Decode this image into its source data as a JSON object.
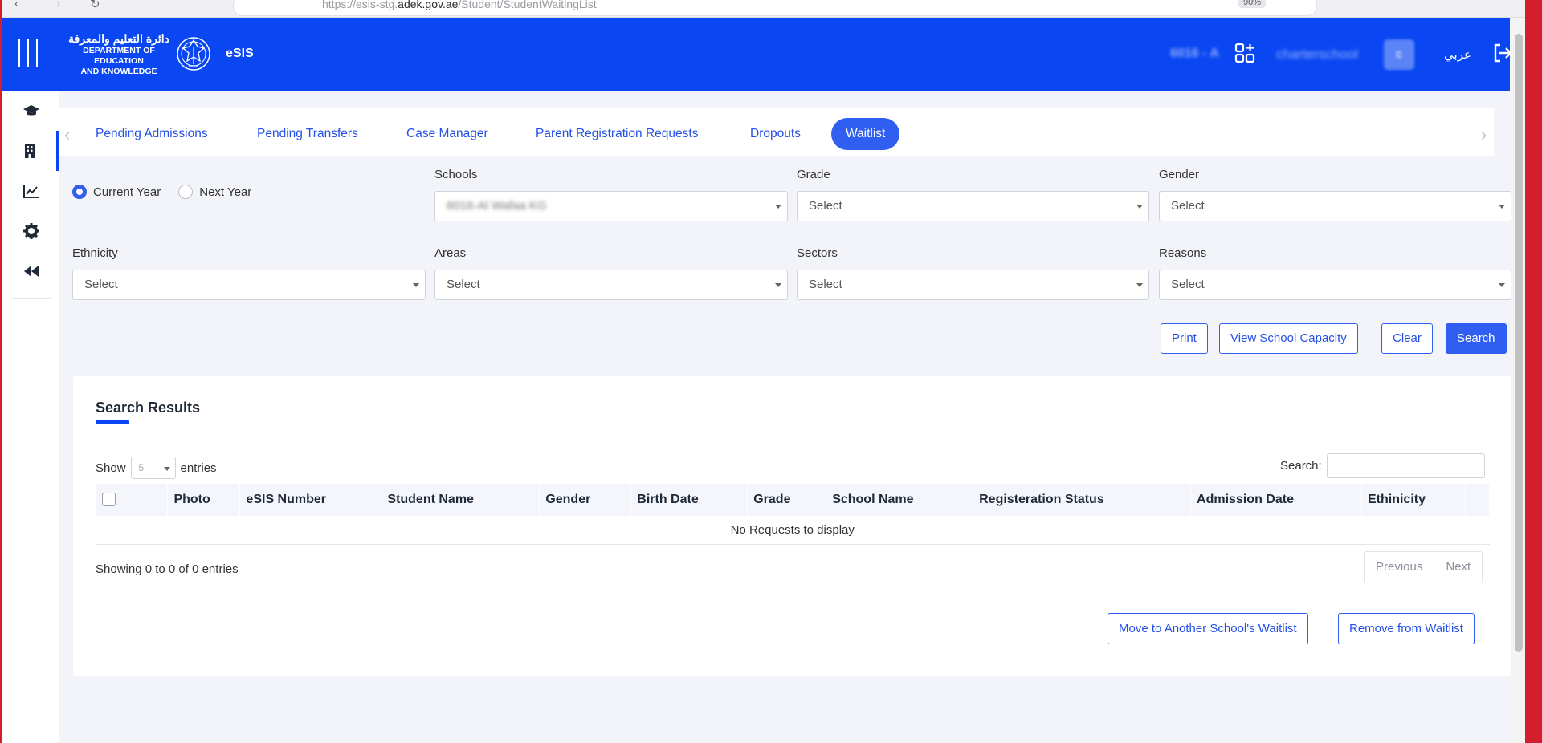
{
  "browser": {
    "url_prefix": "https://esis-stg.",
    "url_domain": "adek.gov.ae",
    "url_path": "/Student/StudentWaitingList",
    "zoom": "90%"
  },
  "header": {
    "logo_arabic": "دائرة التعليم والمعرفة",
    "logo_line1": "DEPARTMENT OF EDUCATION",
    "logo_line2": "AND KNOWLEDGE",
    "app_name": "eSIS",
    "school_code": "6016 - A",
    "user_name": "charterschool",
    "avatar_initial": "c",
    "language_toggle": "عربي",
    "brand_color": "#0a47f2"
  },
  "sidebar": {
    "items": [
      {
        "icon": "graduation-cap-icon"
      },
      {
        "icon": "building-icon",
        "active": true
      },
      {
        "icon": "chart-line-icon"
      },
      {
        "icon": "gear-icon"
      },
      {
        "icon": "rewind-icon"
      }
    ]
  },
  "tabs": [
    {
      "label": "Pending Admissions"
    },
    {
      "label": "Pending Transfers"
    },
    {
      "label": "Case Manager"
    },
    {
      "label": "Parent Registration Requests"
    },
    {
      "label": "Dropouts"
    },
    {
      "label": "Waitlist",
      "active": true
    }
  ],
  "filters": {
    "year_options": [
      {
        "label": "Current Year",
        "checked": true
      },
      {
        "label": "Next Year",
        "checked": false
      }
    ],
    "schools": {
      "label": "Schools",
      "value": "6016-Al Wafaa KG"
    },
    "grade": {
      "label": "Grade",
      "value": "Select"
    },
    "gender": {
      "label": "Gender",
      "value": "Select"
    },
    "ethnicity": {
      "label": "Ethnicity",
      "value": "Select"
    },
    "areas": {
      "label": "Areas",
      "value": "Select"
    },
    "sectors": {
      "label": "Sectors",
      "value": "Select"
    },
    "reasons": {
      "label": "Reasons",
      "value": "Select"
    }
  },
  "actions": {
    "print": "Print",
    "view_capacity": "View School Capacity",
    "clear": "Clear",
    "search": "Search"
  },
  "results": {
    "title": "Search Results",
    "show_label": "Show",
    "entries_value": "5",
    "entries_label": "entries",
    "search_label": "Search:",
    "columns": [
      "Photo",
      "eSIS Number",
      "Student Name",
      "Gender",
      "Birth Date",
      "Grade",
      "School Name",
      "Registeration Status",
      "Admission Date",
      "Ethinicity"
    ],
    "empty_message": "No Requests to display",
    "showing_text": "Showing 0 to 0 of 0 entries",
    "pager_previous": "Previous",
    "pager_next": "Next",
    "move_button": "Move to Another School's Waitlist",
    "remove_button": "Remove from Waitlist"
  }
}
